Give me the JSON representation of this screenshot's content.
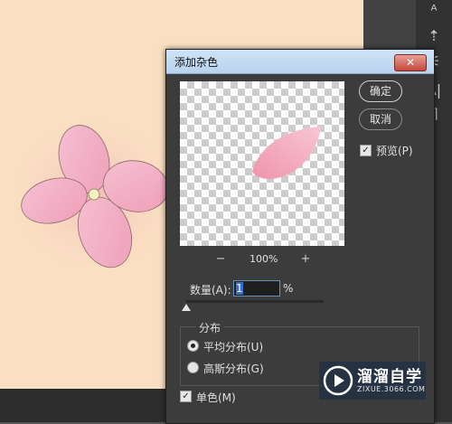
{
  "dialog": {
    "title": "添加杂色",
    "close_glyph": "✕",
    "ok_label": "确定",
    "cancel_label": "取消",
    "preview_label": "预览(P)",
    "preview_checked": true,
    "zoom_out_glyph": "−",
    "zoom_level": "100%",
    "zoom_in_glyph": "+",
    "amount_label": "数量(A):",
    "amount_value": "1",
    "amount_unit": "%",
    "amount_slider_fraction": 0.01,
    "distribution": {
      "legend": "分布",
      "options": [
        {
          "label": "平均分布(U)",
          "selected": true
        },
        {
          "label": "高斯分布(G)",
          "selected": false
        }
      ]
    },
    "mono_label": "单色(M)",
    "mono_checked": true
  },
  "watermark": {
    "title": "溜溜自学",
    "url": "ZIXUE.3066.COM"
  },
  "toolbar": {
    "icons": [
      "paragraph-style-icon",
      "puppet-warp-icon",
      "adjust-sliders-icon",
      "character-icon",
      "paragraph-icon"
    ],
    "glyphs": [
      "ᴬ",
      "⇡",
      "⚟",
      "A|",
      "¶"
    ]
  },
  "colors": {
    "canvas": "#fae0c2",
    "petal": "#f2b6c8",
    "dialog_bg": "#3c3c3c"
  }
}
